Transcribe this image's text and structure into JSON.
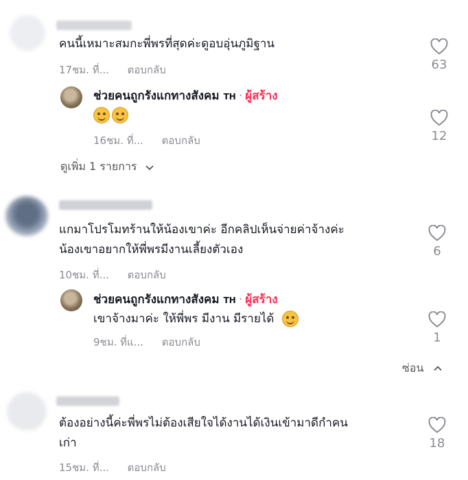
{
  "comments": [
    {
      "text": "คนนี้เหมาะสมกะพี่พรที่สุดค่ะดูอบอุ่นภูมิฐาน",
      "time": "17ชม. ที่...",
      "reply_label": "ตอบกลับ",
      "likes": "63"
    },
    {
      "text_line1": "แกมาโปรโมทร้านให้น้องเขาค่ะ อีกคลิปเห็นจ่ายค่าจ้างค่ะ",
      "text_line2": "น้องเขาอยากให้พี่พรมีงานเลี้ยงตัวเอง",
      "time": "10ชม. ที่...",
      "reply_label": "ตอบกลับ",
      "likes": "6"
    },
    {
      "text_line1": "ต้องอย่างนี้ค่ะพี่พรไม่ต้องเสียใจได้งานได้เงินเข้ามาดีกำคน",
      "text_line2": "เก่า",
      "time": "15ชม. ที่...",
      "reply_label": "ตอบกลับ",
      "likes": "18"
    }
  ],
  "replies": [
    {
      "author": "ช่วยคนถูกรังแกทางสังคม",
      "region": "TH",
      "creator_badge": "ผู้สร้าง",
      "text": "",
      "time": "16ชม. ที่...",
      "reply_label": "ตอบกลับ",
      "likes": "12"
    },
    {
      "author": "ช่วยคนถูกรังแกทางสังคม",
      "region": "TH",
      "creator_badge": "ผู้สร้าง",
      "text": "เขาจ้างมาค่ะ ให้พี่พร มีงาน มีรายได้",
      "time": "9ชม. ที่แ...",
      "reply_label": "ตอบกลับ",
      "likes": "1"
    }
  ],
  "view_more": "ดูเพิ่ม 1 รายการ",
  "hide_label": "ซ่อน",
  "icons": {
    "like": "heart-outline-icon",
    "expand": "chevron-down-icon",
    "collapse": "chevron-up-icon",
    "emoji": "smiling-face-with-hearts-emoji"
  },
  "colors": {
    "creator_badge": "#fe2c55",
    "meta_text": "#8a8b91"
  }
}
